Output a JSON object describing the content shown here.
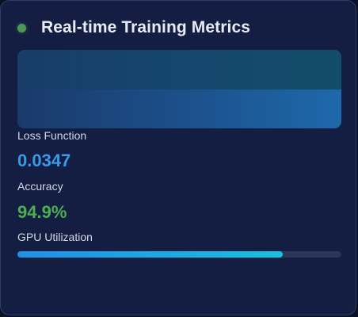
{
  "card": {
    "title": "Real-time Training Metrics",
    "status_color": "#4a9a55"
  },
  "metrics": {
    "loss": {
      "label": "Loss Function",
      "value": "0.0347",
      "color": "#3a9ae8"
    },
    "accuracy": {
      "label": "Accuracy",
      "value": "94.9%",
      "color": "#4caf50"
    },
    "gpu": {
      "label": "GPU Utilization",
      "fraction": 0.82
    }
  }
}
